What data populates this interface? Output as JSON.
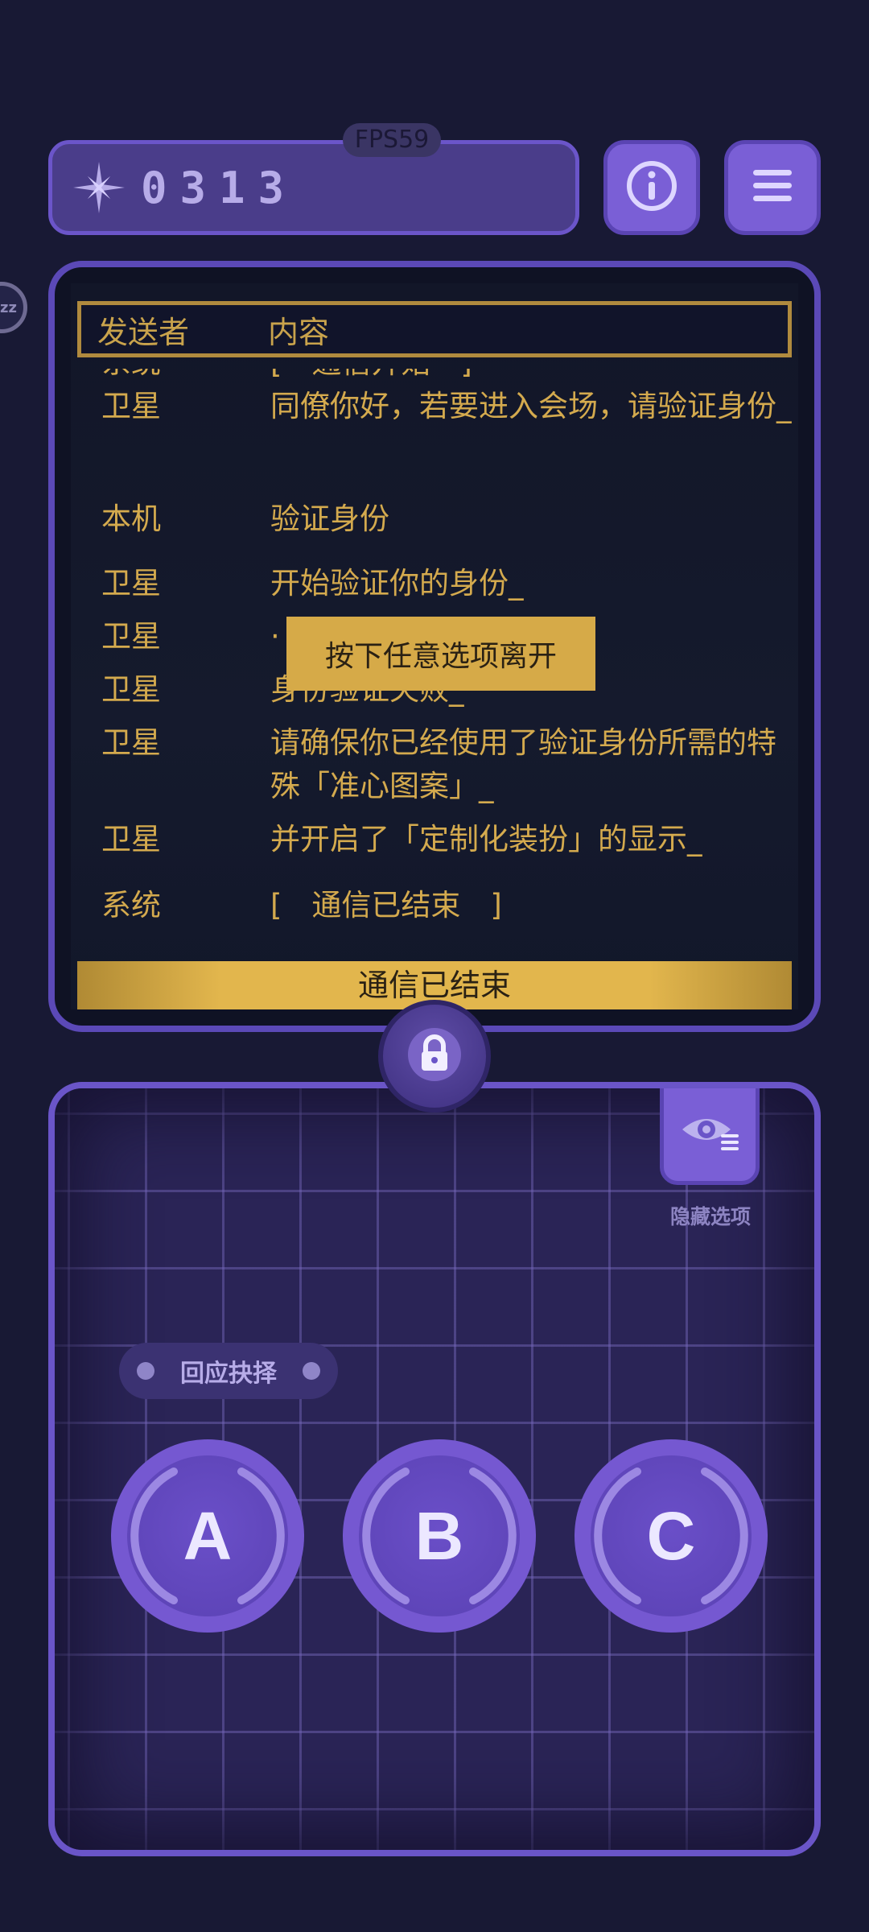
{
  "top_bar": {
    "fps": "FPS59",
    "score": "0313",
    "info_icon": "info-icon",
    "menu_icon": "menu-icon",
    "sleep_badge": "zz"
  },
  "dialog": {
    "columns": {
      "sender": "发送者",
      "content": "内容"
    },
    "messages": [
      {
        "sender": "系统",
        "content": "[　通信开始　]"
      },
      {
        "sender": "卫星",
        "content": "同僚你好，若要进入会场，请验证身份_"
      },
      {
        "sender": "本机",
        "content": "验证身份"
      },
      {
        "sender": "卫星",
        "content": "开始验证你的身份_"
      },
      {
        "sender": "卫星",
        "content": "·"
      },
      {
        "sender": "卫星",
        "content": "身份验证失败_"
      },
      {
        "sender": "卫星",
        "content": "请确保你已经使用了验证身份所需的特殊「准心图案」_"
      },
      {
        "sender": "卫星",
        "content": "并开启了「定制化装扮」的显示_"
      },
      {
        "sender": "系统",
        "content": "[　通信已结束　]"
      }
    ],
    "toast": "按下任意选项离开",
    "end_bar": "通信已结束"
  },
  "controller": {
    "hide_options_label": "隐藏选项",
    "response_label": "回应抉择",
    "choices": [
      "A",
      "B",
      "C"
    ]
  },
  "colors": {
    "panel_border": "#5b49b7",
    "text_gold": "#d4aa4e",
    "button_purple": "#7a5fd6",
    "background": "#181934"
  }
}
